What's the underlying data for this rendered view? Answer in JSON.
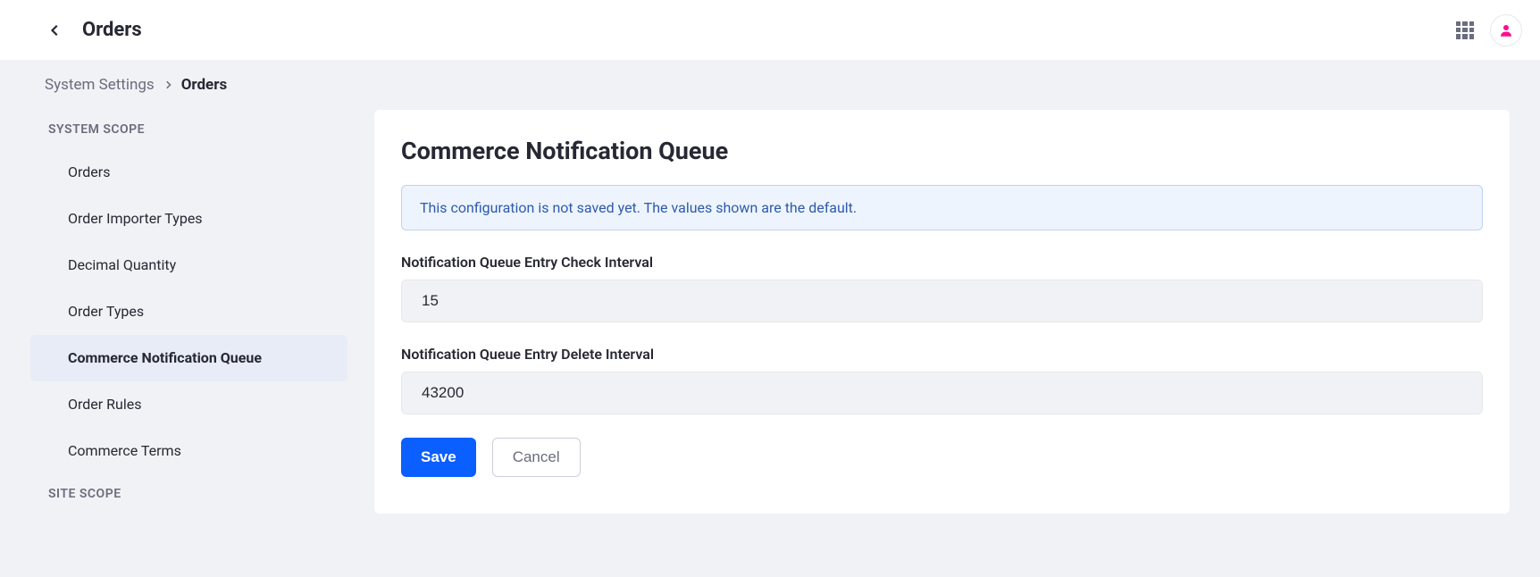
{
  "header": {
    "title": "Orders"
  },
  "breadcrumb": {
    "parent": "System Settings",
    "current": "Orders"
  },
  "sidebar": {
    "headings": {
      "system_scope": "SYSTEM SCOPE",
      "site_scope": "SITE SCOPE"
    },
    "items": [
      {
        "label": "Orders",
        "active": false
      },
      {
        "label": "Order Importer Types",
        "active": false
      },
      {
        "label": "Decimal Quantity",
        "active": false
      },
      {
        "label": "Order Types",
        "active": false
      },
      {
        "label": "Commerce Notification Queue",
        "active": true
      },
      {
        "label": "Order Rules",
        "active": false
      },
      {
        "label": "Commerce Terms",
        "active": false
      }
    ]
  },
  "panel": {
    "title": "Commerce Notification Queue",
    "info": "This configuration is not saved yet. The values shown are the default.",
    "fields": {
      "check_interval": {
        "label": "Notification Queue Entry Check Interval",
        "value": "15"
      },
      "delete_interval": {
        "label": "Notification Queue Entry Delete Interval",
        "value": "43200"
      }
    },
    "buttons": {
      "save": "Save",
      "cancel": "Cancel"
    }
  }
}
